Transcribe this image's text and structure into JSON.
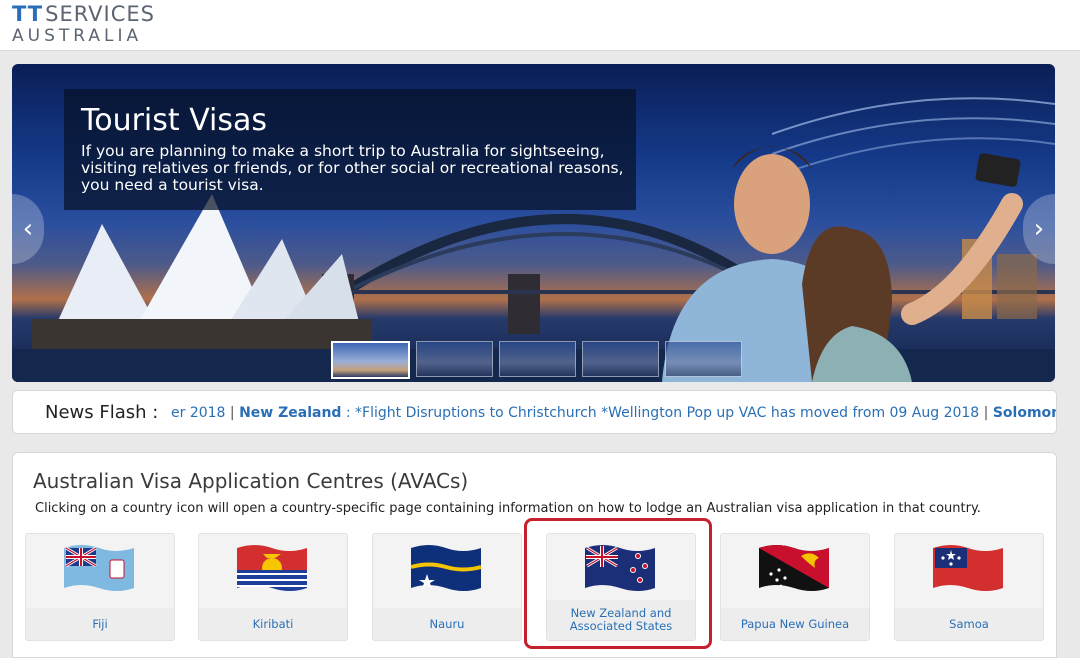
{
  "header": {
    "logo_tt": "TT",
    "logo_line1": "SERVICES",
    "logo_line2": "AUSTRALIA"
  },
  "hero": {
    "title": "Tourist Visas",
    "text": "If you are planning to make a short trip to Australia for sightseeing, visiting relatives or friends, or for other social or recreational reasons, you need a tourist visa.",
    "prev_arrow": "‹",
    "next_arrow": "›",
    "thumbnail_count": 5,
    "active_thumbnail": 1
  },
  "news": {
    "label": "News Flash :",
    "prefix": "er 2018",
    "country": "New Zealand",
    "item": ": *Flight Disruptions to Christchurch *Wellington Pop up VAC has moved from 09 Aug 2018",
    "next_country": "Solomon Islands"
  },
  "avac": {
    "title": "Australian Visa Application Centres (AVACs)",
    "description": "Clicking on a country icon will open a country-specific page containing information on how to lodge an Australian visa application in that country.",
    "countries": [
      {
        "name": "Fiji"
      },
      {
        "name": "Kiribati"
      },
      {
        "name": "Nauru"
      },
      {
        "name": "New Zealand and Associated States"
      },
      {
        "name": "Papua New Guinea"
      },
      {
        "name": "Samoa"
      }
    ]
  },
  "colors": {
    "link": "#2a6fb5",
    "highlight": "#c4202e",
    "logo_accent": "#2a6db8"
  }
}
